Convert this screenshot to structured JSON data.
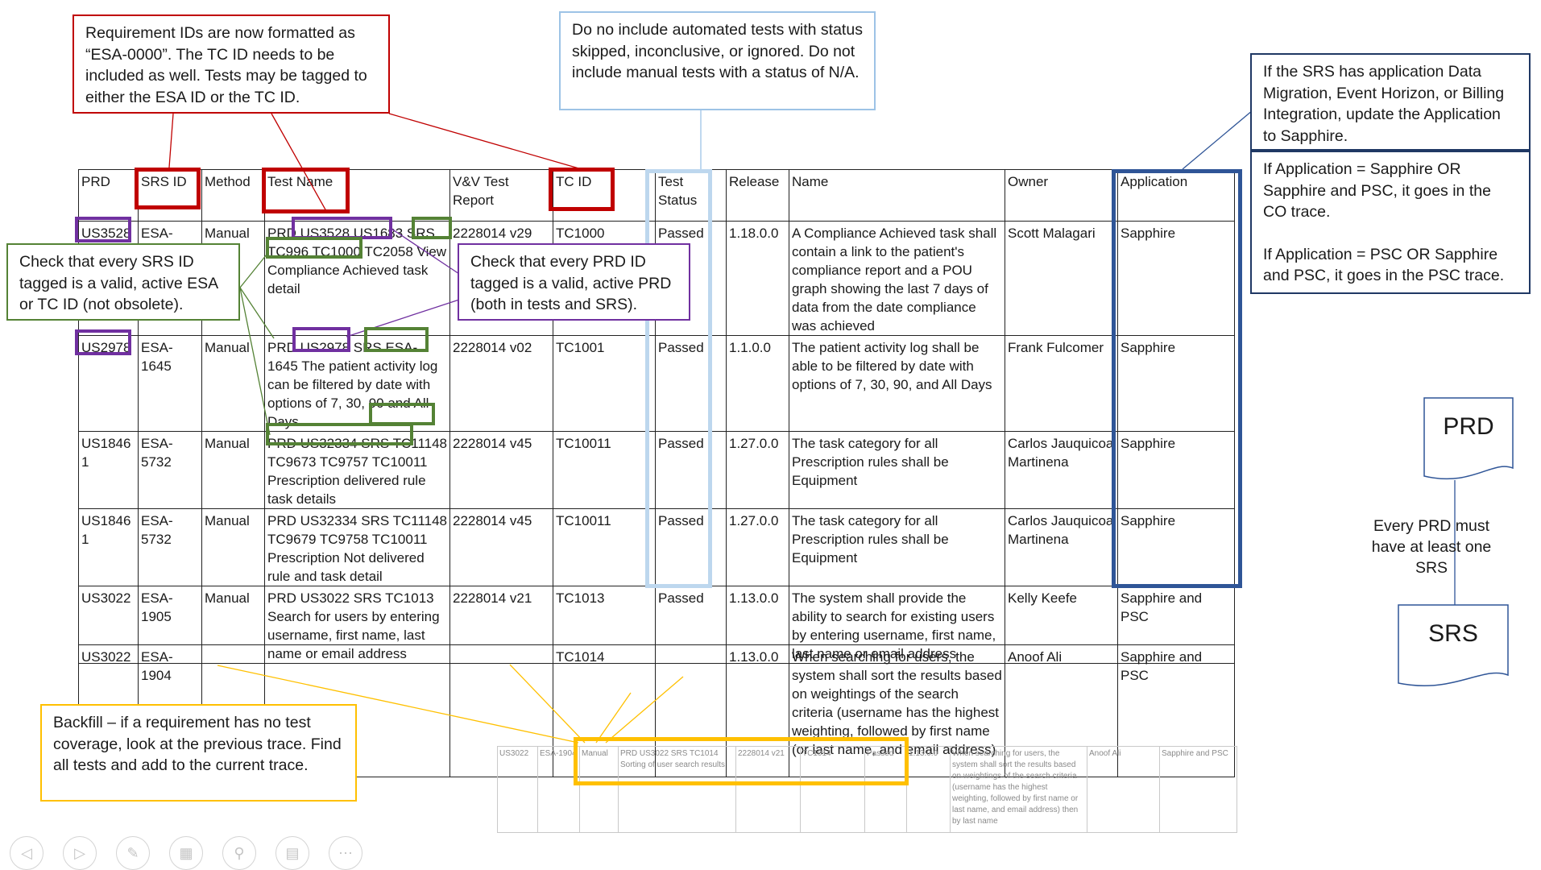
{
  "table": {
    "headers": [
      "PRD",
      "SRS ID",
      "Method",
      "Test Name",
      "V&V Test Report",
      "TC ID",
      "Test Status",
      "Release",
      "Name",
      "Owner",
      "Application"
    ],
    "rows": [
      [
        "US3528",
        "ESA-1644",
        "Manual",
        "PRD US3528 US1683 SRS TC996 TC1000 TC2058 View Compliance Achieved task detail",
        "2228014 v29",
        "TC1000",
        "Passed",
        "1.18.0.0",
        "A Compliance Achieved task shall contain a link to the patient's compliance report and a POU graph showing the last 7 days of data from the date compliance was achieved",
        "Scott Malagari",
        "Sapphire"
      ],
      [
        "US2978",
        "ESA-1645",
        "Manual",
        "PRD US2978 SRS ESA-1645 The patient activity log can be filtered by date with options of 7, 30, 90 and All Days",
        "2228014 v02",
        "TC1001",
        "Passed",
        "1.1.0.0",
        "The patient activity log shall be able to be filtered by date with options of 7, 30, 90, and All Days",
        "Frank Fulcomer",
        "Sapphire"
      ],
      [
        "US18461",
        "ESA-5732",
        "Manual",
        "PRD US32334 SRS TC11148 TC9673 TC9757 TC10011 Prescription delivered rule task details",
        "2228014 v45",
        "TC10011",
        "Passed",
        "1.27.0.0",
        "The task category for all Prescription rules shall be Equipment",
        "Carlos Jauquicoa Martinena",
        "Sapphire"
      ],
      [
        "US18461",
        "ESA-5732",
        "Manual",
        "PRD US32334 SRS TC11148 TC9679 TC9758 TC10011 Prescription Not delivered rule and task detail",
        "2228014 v45",
        "TC10011",
        "Passed",
        "1.27.0.0",
        "The task category for all Prescription rules shall be Equipment",
        "Carlos Jauquicoa Martinena",
        "Sapphire"
      ],
      [
        "US3022",
        "ESA-1905",
        "Manual",
        "PRD US3022 SRS TC1013 Search for users by entering username, first name, last name or email address",
        "2228014 v21",
        "TC1013",
        "Passed",
        "1.13.0.0",
        "The system shall provide the ability to search for existing users by entering username, first name, last name or email address",
        "Kelly Keefe",
        "Sapphire and PSC"
      ]
    ]
  },
  "lower_row": [
    "US3022",
    "ESA-1904",
    "",
    "",
    "",
    "TC1014",
    "",
    "1.13.0.0",
    "When searching for users, the system shall sort the results based on weightings of the search criteria (username has the highest weighting, followed by first name (or last name, and email address)",
    "Anoof Ali",
    "Sapphire and PSC"
  ],
  "faded_row": [
    "US3022",
    "ESA-1904",
    "Manual",
    "PRD US3022 SRS TC1014 Sorting of user search results",
    "2228014 v21",
    "TC1014",
    "Passed",
    "1.13.0.0",
    "When searching for users, the system shall sort the results based on weightings of the search criteria (username has the highest weighting, followed by first name or last name, and email address) then by last name",
    "Anoof Ali",
    "Sapphire and PSC"
  ],
  "callouts": {
    "req_ids": "Requirement IDs are now formatted as “ESA-0000”.  The TC ID needs to be included as well. Tests may be tagged to either the ESA ID or the TC ID.",
    "exclude": "Do no include automated tests with status skipped, inconclusive, or ignored. Do not include manual tests with a status of N/A.",
    "app_update": "If the SRS has application Data Migration, Event Horizon, or Billing Integration, update the Application to Sapphire.",
    "app_trace_1": "If Application = Sapphire OR Sapphire and PSC, it goes in the CO trace.",
    "app_trace_2": "If Application = PSC OR Sapphire and PSC, it goes in the PSC trace.",
    "srs_check": "Check that every SRS ID tagged is a valid, active ESA or TC ID (not obsolete).",
    "prd_check": "Check that every PRD ID tagged is a valid, active PRD (both in tests and SRS).",
    "backfill": "Backfill – if a requirement has no test coverage, look at the previous trace. Find all tests and add to the current trace."
  },
  "diagram": {
    "prd_label": "PRD",
    "srs_label": "SRS",
    "note": "Every PRD must have at least one SRS"
  },
  "colors": {
    "red": "#c00000",
    "purple": "#7030a0",
    "green": "#548235",
    "light_blue": "#bdd7ee",
    "navy": "#2f5597",
    "yellow": "#ffc000"
  },
  "toolbar": [
    "arrow-left-icon",
    "arrow-right-icon",
    "pen-icon",
    "slides-icon",
    "zoom-icon",
    "subtitles-icon",
    "more-icon"
  ]
}
